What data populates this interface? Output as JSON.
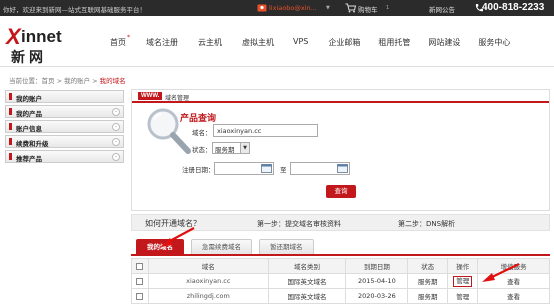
{
  "topbar": {
    "welcome": "你好，欢迎来到新网—站式互联网基础服务平台！",
    "user": "lixiaobo@xin...",
    "cart": "购物车",
    "cart_count": "1",
    "notice": "新网公告",
    "phone": "400-818-2233"
  },
  "logo": {
    "x": "X",
    "innet": "innet",
    "cn": "新网"
  },
  "nav": [
    "首页",
    "域名注册",
    "云主机",
    "虚拟主机",
    "VPS",
    "企业邮箱",
    "租用托管",
    "网站建设",
    "服务中心"
  ],
  "nav_badge": "*",
  "breadcrumb": {
    "prefix": "当前位置：首页 > 我的账户 > ",
    "current": "我的域名"
  },
  "sidebar": {
    "items": [
      {
        "label": "我的账户",
        "toggle": ""
      },
      {
        "label": "我的产品",
        "toggle": "-"
      },
      {
        "label": "账户信息",
        "toggle": "-"
      },
      {
        "label": "续费和升级",
        "toggle": "-"
      },
      {
        "label": "推荐产品",
        "toggle": "-"
      }
    ]
  },
  "panel": {
    "tag": "WWW.",
    "title": "域名管理"
  },
  "query": {
    "title": "产品查询",
    "domain_label": "域名：",
    "domain_value": "xiaoxinyan.cc",
    "status_label": "状态：",
    "status_value": "服务期",
    "date_label": "注册日期：",
    "date_sep": "至",
    "button": "查询"
  },
  "howto": {
    "question": "如何开通域名？",
    "step1": "第一步：提交域名审核资料",
    "step2": "第二步：DNS解析"
  },
  "tabs": [
    "我的域名",
    "急需续费域名",
    "暂还期域名"
  ],
  "table": {
    "headers": [
      "",
      "域名",
      "域名类别",
      "到期日期",
      "状态",
      "操作",
      "增值服务"
    ],
    "rows": [
      {
        "domain": "xiaoxinyan.cc",
        "category": "国际英文域名",
        "expiry": "2015-04-10",
        "status": "服务期",
        "action": "管理",
        "service": "查看"
      },
      {
        "domain": "zhilingdj.com",
        "category": "国际英文域名",
        "expiry": "2020-03-26",
        "status": "服务期",
        "action": "管理",
        "service": "查看"
      }
    ]
  },
  "colors": {
    "brand_red": "#c2181c",
    "topbar": "#2b2b2b"
  }
}
